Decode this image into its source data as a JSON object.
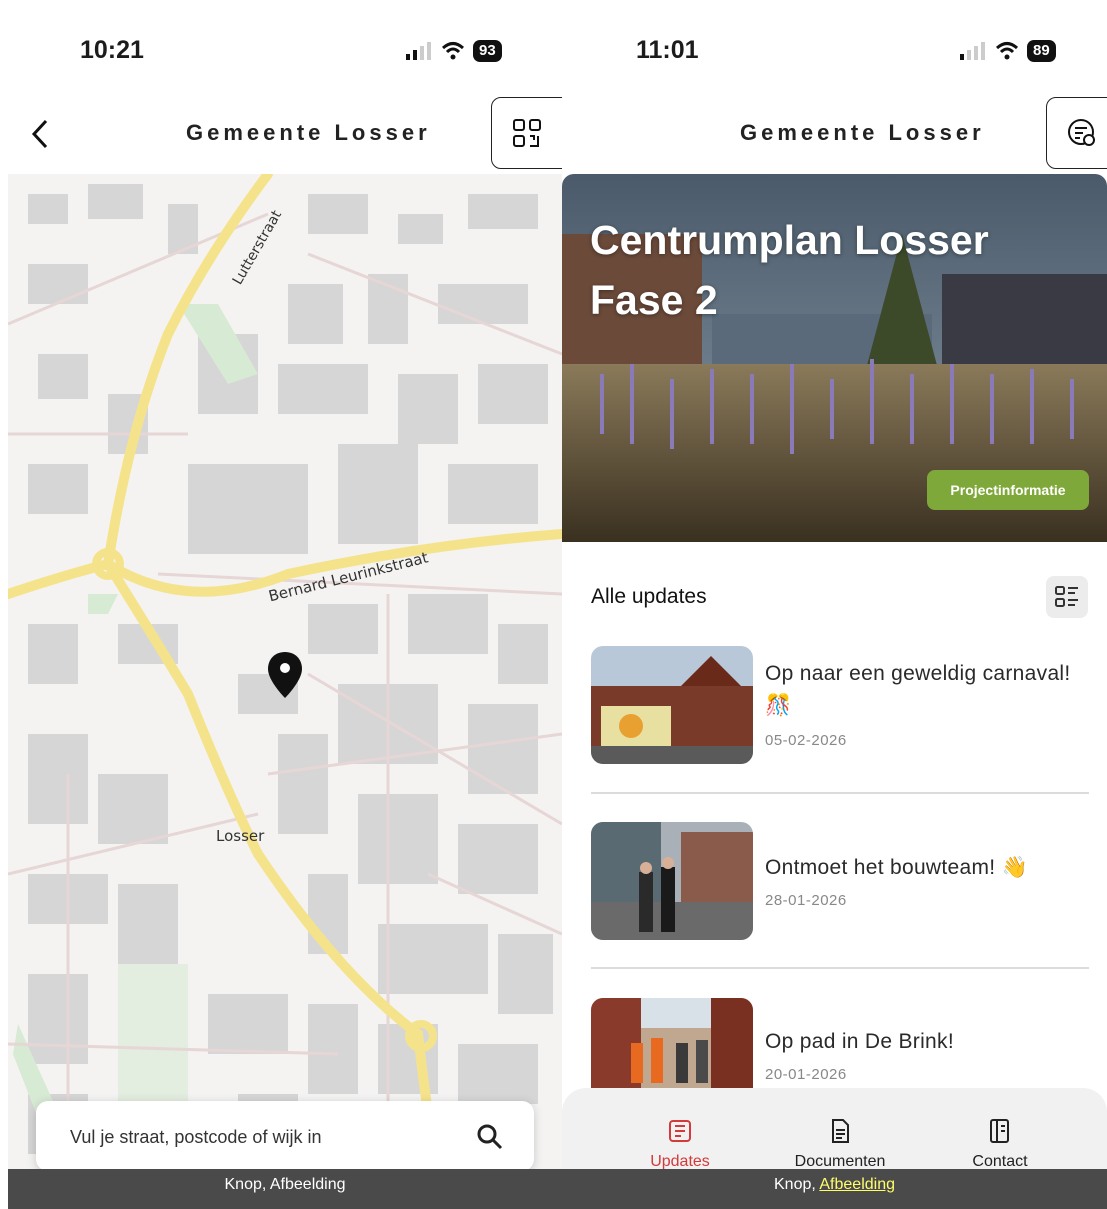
{
  "left_screen": {
    "status": {
      "time": "10:21",
      "battery": "93"
    },
    "header": {
      "title": "Gemeente Losser"
    },
    "map": {
      "street_labels": [
        "Lutterstraat",
        "Bernard Leurinkstraat",
        "Losser"
      ]
    },
    "search": {
      "placeholder": "Vul je straat, postcode of wijk in"
    },
    "a11y_bar": {
      "text": "Knop, Afbeelding"
    }
  },
  "right_screen": {
    "status": {
      "time": "11:01",
      "battery": "89"
    },
    "header": {
      "title": "Gemeente Losser"
    },
    "hero": {
      "title": "Centrumplan Losser Fase 2",
      "button_label": "Projectinformatie"
    },
    "updates": {
      "heading": "Alle updates",
      "items": [
        {
          "title": "Op naar een geweldig carnaval! 🎊",
          "date": "05-02-2026"
        },
        {
          "title": "Ontmoet het bouwteam! 👋",
          "date": "28-01-2026"
        },
        {
          "title": "Op pad in De Brink!",
          "date": "20-01-2026"
        }
      ]
    },
    "bottom_nav": {
      "tabs": [
        {
          "label": "Updates",
          "active": true
        },
        {
          "label": "Documenten",
          "active": false
        },
        {
          "label": "Contact",
          "active": false
        }
      ],
      "active_color": "#d33a3a"
    },
    "a11y_bar": {
      "prefix": "Knop, ",
      "link": "Afbeelding"
    }
  }
}
